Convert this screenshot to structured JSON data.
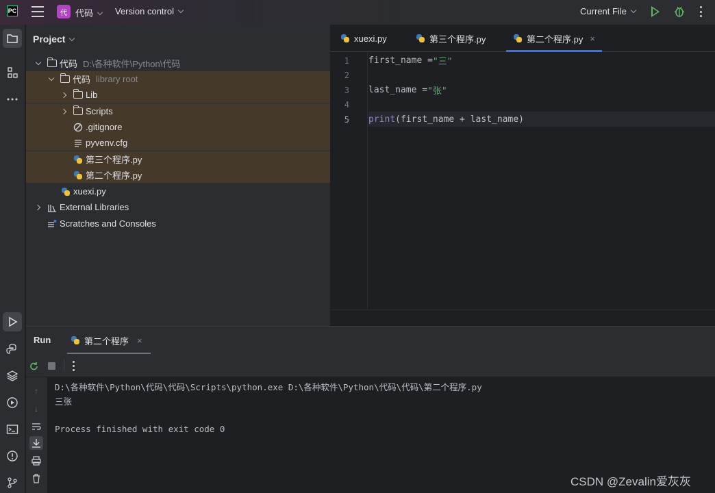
{
  "titlebar": {
    "logo_text": "PC",
    "project_badge": "代",
    "project_name": "代码",
    "version_control": "Version control",
    "run_config": "Current File"
  },
  "project_panel": {
    "header": "Project",
    "tree": [
      {
        "label": "代码",
        "hint": "D:\\各种软件\\Python\\代码",
        "icon": "folder-icon",
        "arrow": "down",
        "indent": 0
      },
      {
        "label": "代码",
        "hint": "library root",
        "icon": "folder-icon",
        "arrow": "down",
        "indent": 1
      },
      {
        "label": "Lib",
        "hint": "",
        "icon": "folder-icon",
        "arrow": "right",
        "indent": 2
      },
      {
        "label": "Scripts",
        "hint": "",
        "icon": "folder-icon",
        "arrow": "right",
        "indent": 2
      },
      {
        "label": ".gitignore",
        "hint": "",
        "icon": "ignore-icon",
        "arrow": "none",
        "indent": 2
      },
      {
        "label": "pyvenv.cfg",
        "hint": "",
        "icon": "text-file-icon",
        "arrow": "none",
        "indent": 2
      },
      {
        "label": "第三个程序.py",
        "hint": "",
        "icon": "python-icon",
        "arrow": "none",
        "indent": 2
      },
      {
        "label": "第二个程序.py",
        "hint": "",
        "icon": "python-icon",
        "arrow": "none",
        "indent": 2
      },
      {
        "label": "xuexi.py",
        "hint": "",
        "icon": "python-icon",
        "arrow": "none",
        "indent": 1
      },
      {
        "label": "External Libraries",
        "hint": "",
        "icon": "library-icon",
        "arrow": "right",
        "indent": 0
      },
      {
        "label": "Scratches and Consoles",
        "hint": "",
        "icon": "scratch-icon",
        "arrow": "none",
        "indent": 0
      }
    ]
  },
  "editor": {
    "tabs": [
      {
        "label": "xuexi.py"
      },
      {
        "label": "第三个程序.py"
      },
      {
        "label": "第二个程序.py",
        "active": true,
        "close": "×"
      }
    ],
    "line_numbers": [
      "1",
      "2",
      "3",
      "4",
      "5"
    ],
    "lines": {
      "l1_var": "first_name = ",
      "l1_str": "\"三\"",
      "l3_var": "last_name = ",
      "l3_str": "\"张\"",
      "l5_fn": "print",
      "l5_rest": "(first_name + last_name)"
    }
  },
  "run_panel": {
    "title": "Run",
    "tab_label": "第二个程序",
    "tab_close": "×",
    "console": [
      "D:\\各种软件\\Python\\代码\\代码\\Scripts\\python.exe D:\\各种软件\\Python\\代码\\代码\\第二个程序.py",
      "三张",
      "",
      "Process finished with exit code 0"
    ]
  },
  "watermark": "CSDN @Zevalin爱灰灰",
  "colors": {
    "accent": "#3574f0",
    "run_green": "#5fb865",
    "string_green": "#6aab73",
    "highlight_folder_bg": "#45392a"
  }
}
